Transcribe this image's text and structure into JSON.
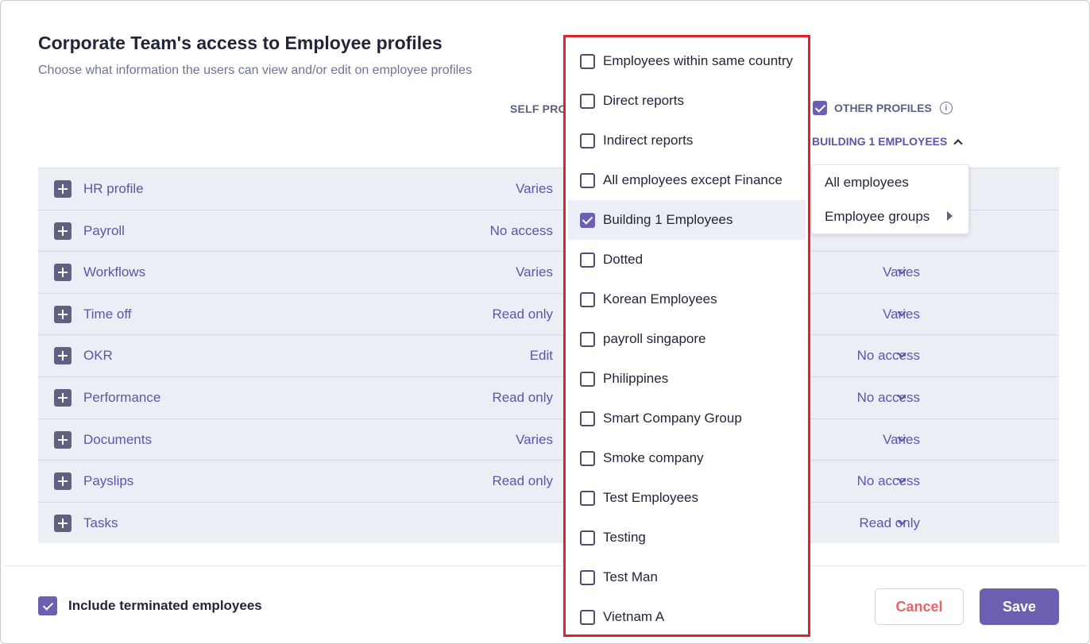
{
  "header": {
    "title": "Corporate Team's access to Employee profiles",
    "subtitle": "Choose what information the users can view and/or edit on employee profiles"
  },
  "columns": {
    "self_profile": "SELF PROFILE",
    "other_profiles": "OTHER PROFILES",
    "other_profiles_checked": true,
    "scope": "BUILDING 1 EMPLOYEES"
  },
  "rows": [
    {
      "label": "HR profile",
      "self": "Varies",
      "other": ""
    },
    {
      "label": "Payroll",
      "self": "No access",
      "other": ""
    },
    {
      "label": "Workflows",
      "self": "Varies",
      "other": "Varies"
    },
    {
      "label": "Time off",
      "self": "Read only",
      "other": "Varies"
    },
    {
      "label": "OKR",
      "self": "Edit",
      "other": "No access"
    },
    {
      "label": "Performance",
      "self": "Read only",
      "other": "No access"
    },
    {
      "label": "Documents",
      "self": "Varies",
      "other": "Varies"
    },
    {
      "label": "Payslips",
      "self": "Read only",
      "other": "No access"
    },
    {
      "label": "Tasks",
      "self": "",
      "other": "Read only"
    }
  ],
  "scope_menu": {
    "items": [
      "All employees",
      "Employee groups"
    ]
  },
  "groups": [
    {
      "label": "Employees within same country",
      "checked": false
    },
    {
      "label": "Direct reports",
      "checked": false
    },
    {
      "label": "Indirect reports",
      "checked": false
    },
    {
      "label": "All employees except Finance",
      "checked": false
    },
    {
      "label": "Building 1 Employees",
      "checked": true
    },
    {
      "label": "Dotted",
      "checked": false
    },
    {
      "label": "Korean Employees",
      "checked": false
    },
    {
      "label": "payroll singapore",
      "checked": false
    },
    {
      "label": "Philippines",
      "checked": false
    },
    {
      "label": "Smart Company Group",
      "checked": false
    },
    {
      "label": "Smoke company",
      "checked": false
    },
    {
      "label": "Test Employees",
      "checked": false
    },
    {
      "label": "Testing",
      "checked": false
    },
    {
      "label": "Test Man",
      "checked": false
    },
    {
      "label": "Vietnam A",
      "checked": false
    }
  ],
  "footer": {
    "include_terminated_label": "Include terminated employees",
    "include_terminated_checked": true,
    "cancel_label": "Cancel",
    "save_label": "Save"
  },
  "colors": {
    "accent": "#6a5fb0",
    "link": "#5b56a8",
    "highlight_border": "#e0222d",
    "row_bg": "#eceef6",
    "cancel_text": "#e5666a"
  }
}
